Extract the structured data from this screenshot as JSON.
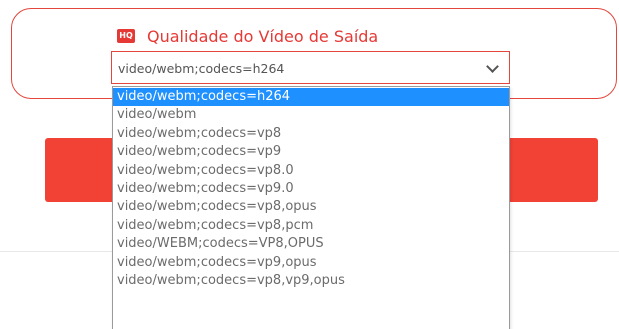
{
  "section": {
    "icon_text": "HQ",
    "title": "Qualidade do Vídeo de Saída"
  },
  "select": {
    "value": "video/webm;codecs=h264",
    "options": [
      "video/webm;codecs=h264",
      "video/webm",
      "video/webm;codecs=vp8",
      "video/webm;codecs=vp9",
      "video/webm;codecs=vp8.0",
      "video/webm;codecs=vp9.0",
      "video/webm;codecs=vp8,opus",
      "video/webm;codecs=vp8,pcm",
      "video/WEBM;codecs=VP8,OPUS",
      "video/webm;codecs=vp9,opus",
      "video/webm;codecs=vp8,vp9,opus"
    ],
    "selected_index": 0
  },
  "colors": {
    "accent": "#e53935",
    "button": "#f24236",
    "highlight": "#1e90ff"
  }
}
